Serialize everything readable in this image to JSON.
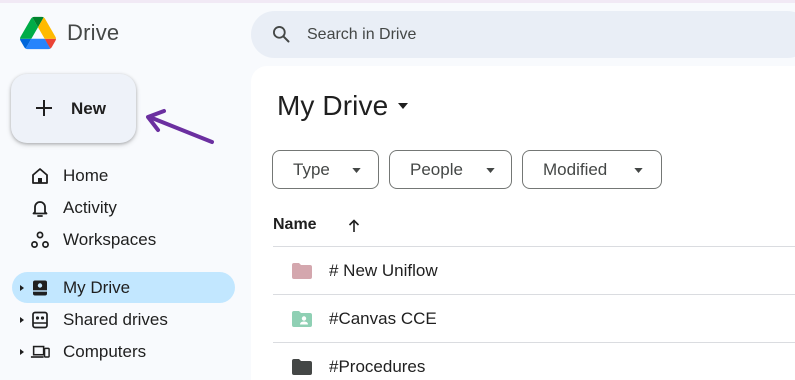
{
  "app": {
    "name": "Drive",
    "logo_colors": [
      "#0066da",
      "#00ac47",
      "#ea4335",
      "#00832d",
      "#2684fc",
      "#ffba00"
    ]
  },
  "search": {
    "placeholder": "Search in Drive",
    "icon": "search-icon"
  },
  "new_button": {
    "label": "New",
    "icon": "plus-icon"
  },
  "annotation": {
    "arrow_color": "#6b2fa0"
  },
  "sidebar": {
    "items": [
      {
        "label": "Home",
        "icon": "home-icon",
        "active": false,
        "expandable": false
      },
      {
        "label": "Activity",
        "icon": "bell-icon",
        "active": false,
        "expandable": false
      },
      {
        "label": "Workspaces",
        "icon": "workspaces-icon",
        "active": false,
        "expandable": false
      },
      {
        "label": "My Drive",
        "icon": "my-drive-icon",
        "active": true,
        "expandable": true
      },
      {
        "label": "Shared drives",
        "icon": "shared-drives-icon",
        "active": false,
        "expandable": true
      },
      {
        "label": "Computers",
        "icon": "computers-icon",
        "active": false,
        "expandable": true
      }
    ],
    "active_color": "#c2e7ff"
  },
  "main": {
    "title": "My Drive",
    "filters": [
      {
        "label": "Type"
      },
      {
        "label": "People"
      },
      {
        "label": "Modified"
      }
    ],
    "list": {
      "column_name": "Name",
      "sort": "ascending",
      "rows": [
        {
          "name": "# New Uniflow",
          "icon": "folder-icon",
          "color": "#d4a7ae",
          "shared": false
        },
        {
          "name": "#Canvas CCE",
          "icon": "shared-folder-icon",
          "color": "#8fd0b4",
          "shared": true
        },
        {
          "name": "#Procedures",
          "icon": "folder-icon",
          "color": "#444746",
          "shared": false
        }
      ]
    }
  }
}
